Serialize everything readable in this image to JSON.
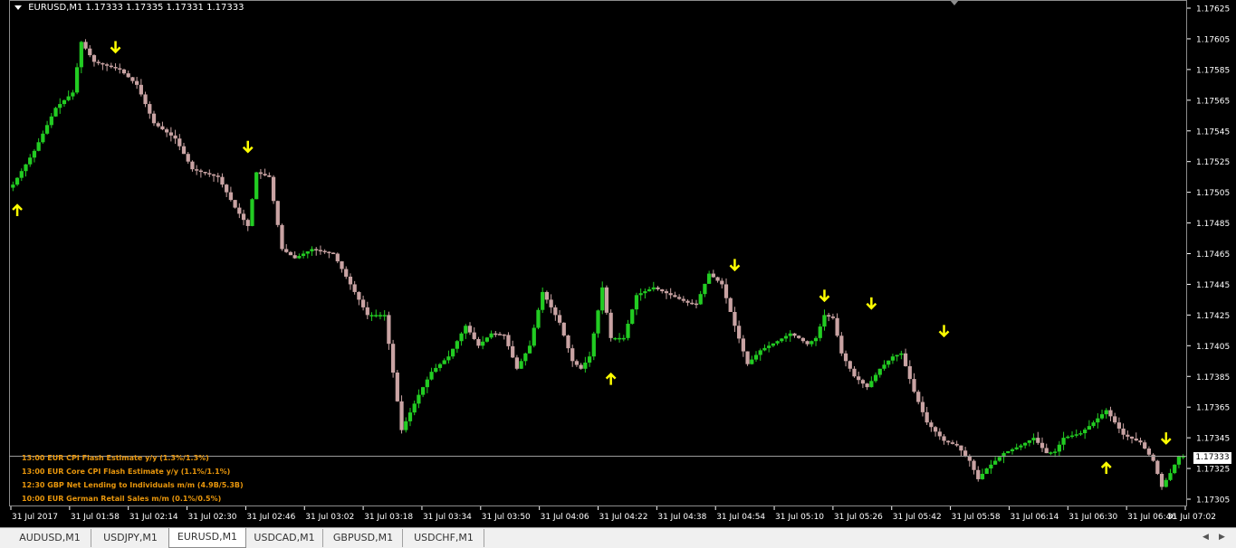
{
  "header": {
    "title": "EURUSD,M1  1.17333 1.17335 1.17331 1.17333"
  },
  "events": [
    "13:00 EUR CPI Flash Estimate y/y  (1.3%/1.3%)",
    "13:00 EUR Core CPI Flash Estimate y/y  (1.1%/1.1%)",
    "12:30 GBP Net Lending to Individuals m/m  (4.9B/5.3B)",
    "10:00 EUR German Retail Sales m/m  (0.1%/0.5%)"
  ],
  "current_price_label": "1.17333",
  "tabs": [
    {
      "label": "AUDUSD,M1",
      "active": false
    },
    {
      "label": "USDJPY,M1",
      "active": false
    },
    {
      "label": "EURUSD,M1",
      "active": true
    },
    {
      "label": "USDCAD,M1",
      "active": false
    },
    {
      "label": "GBPUSD,M1",
      "active": false
    },
    {
      "label": "USDCHF,M1",
      "active": false
    }
  ],
  "colors": {
    "bull": "#22cc22",
    "bear": "#c9a3a3",
    "background": "#000000",
    "arrow": "#ffff00",
    "axis": "#ffffff",
    "event_text": "#e8960c"
  },
  "chart_data": {
    "type": "candlestick",
    "symbol": "EURUSD",
    "timeframe": "M1",
    "ylim": [
      1.17305,
      1.17625
    ],
    "y_ticks": [
      "1.17625",
      "1.17605",
      "1.17585",
      "1.17565",
      "1.17545",
      "1.17525",
      "1.17505",
      "1.17485",
      "1.17465",
      "1.17445",
      "1.17425",
      "1.17405",
      "1.17385",
      "1.17365",
      "1.17345",
      "1.17325",
      "1.17305"
    ],
    "x_ticks": [
      "31 Jul 2017",
      "31 Jul 01:58",
      "31 Jul 02:14",
      "31 Jul 02:30",
      "31 Jul 02:46",
      "31 Jul 03:02",
      "31 Jul 03:18",
      "31 Jul 03:34",
      "31 Jul 03:50",
      "31 Jul 04:06",
      "31 Jul 04:22",
      "31 Jul 04:38",
      "31 Jul 04:54",
      "31 Jul 05:10",
      "31 Jul 05:26",
      "31 Jul 05:42",
      "31 Jul 05:58",
      "31 Jul 06:14",
      "31 Jul 06:30",
      "31 Jul 06:46",
      "31 Jul 07:02"
    ],
    "current_price": 1.17333,
    "price_path": [
      [
        0,
        1.1751
      ],
      [
        5,
        1.17532
      ],
      [
        10,
        1.1756
      ],
      [
        14,
        1.1757
      ],
      [
        16,
        1.17603
      ],
      [
        19,
        1.1759
      ],
      [
        25,
        1.17585
      ],
      [
        29,
        1.17575
      ],
      [
        33,
        1.1755
      ],
      [
        38,
        1.1754
      ],
      [
        42,
        1.1752
      ],
      [
        48,
        1.17515
      ],
      [
        52,
        1.17495
      ],
      [
        55,
        1.17483
      ],
      [
        57,
        1.17518
      ],
      [
        60,
        1.17515
      ],
      [
        63,
        1.17468
      ],
      [
        66,
        1.17462
      ],
      [
        70,
        1.17468
      ],
      [
        75,
        1.17465
      ],
      [
        79,
        1.17445
      ],
      [
        83,
        1.17425
      ],
      [
        87,
        1.17425
      ],
      [
        91,
        1.1735
      ],
      [
        95,
        1.17373
      ],
      [
        98,
        1.17388
      ],
      [
        102,
        1.17398
      ],
      [
        106,
        1.17418
      ],
      [
        109,
        1.17405
      ],
      [
        112,
        1.17413
      ],
      [
        115,
        1.17412
      ],
      [
        118,
        1.1739
      ],
      [
        121,
        1.17405
      ],
      [
        124,
        1.1744
      ],
      [
        128,
        1.1742
      ],
      [
        131,
        1.17395
      ],
      [
        133,
        1.1739
      ],
      [
        135,
        1.17398
      ],
      [
        138,
        1.17443
      ],
      [
        140,
        1.1741
      ],
      [
        143,
        1.1741
      ],
      [
        146,
        1.17438
      ],
      [
        150,
        1.17443
      ],
      [
        154,
        1.17438
      ],
      [
        158,
        1.17433
      ],
      [
        160,
        1.17432
      ],
      [
        163,
        1.17452
      ],
      [
        166,
        1.17445
      ],
      [
        169,
        1.17418
      ],
      [
        172,
        1.17393
      ],
      [
        175,
        1.17402
      ],
      [
        179,
        1.17408
      ],
      [
        182,
        1.17413
      ],
      [
        184,
        1.1741
      ],
      [
        186,
        1.17406
      ],
      [
        188,
        1.1741
      ],
      [
        190,
        1.17425
      ],
      [
        192,
        1.17423
      ],
      [
        194,
        1.174
      ],
      [
        197,
        1.17385
      ],
      [
        200,
        1.17378
      ],
      [
        203,
        1.1739
      ],
      [
        206,
        1.17398
      ],
      [
        208,
        1.174
      ],
      [
        211,
        1.17375
      ],
      [
        214,
        1.17355
      ],
      [
        218,
        1.17343
      ],
      [
        221,
        1.1734
      ],
      [
        224,
        1.1733
      ],
      [
        226,
        1.17318
      ],
      [
        228,
        1.17325
      ],
      [
        232,
        1.17335
      ],
      [
        236,
        1.1734
      ],
      [
        239,
        1.17345
      ],
      [
        242,
        1.17335
      ],
      [
        244,
        1.17336
      ],
      [
        246,
        1.17345
      ],
      [
        250,
        1.17348
      ],
      [
        253,
        1.17355
      ],
      [
        256,
        1.17363
      ],
      [
        260,
        1.17347
      ],
      [
        264,
        1.17342
      ],
      [
        267,
        1.1733
      ],
      [
        269,
        1.17313
      ],
      [
        271,
        1.17322
      ],
      [
        273,
        1.17333
      ]
    ],
    "bars_count": 275,
    "up_arrows": [
      [
        1,
        1.17493
      ],
      [
        140,
        1.17383
      ],
      [
        256,
        1.17325
      ]
    ],
    "down_arrows": [
      [
        24,
        1.176
      ],
      [
        55,
        1.17535
      ],
      [
        169,
        1.17458
      ],
      [
        190,
        1.17438
      ],
      [
        201,
        1.17433
      ],
      [
        218,
        1.17415
      ],
      [
        270,
        1.17345
      ]
    ]
  }
}
